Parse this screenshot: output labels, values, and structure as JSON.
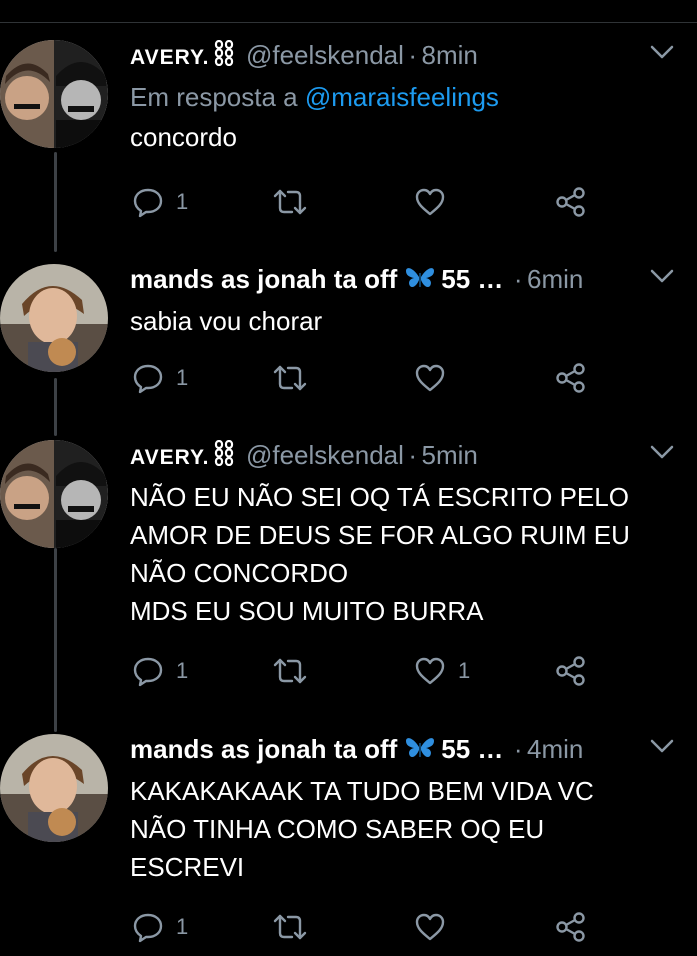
{
  "colors": {
    "background": "#000000",
    "text_primary": "#ffffff",
    "text_secondary": "#8b98a5",
    "mention": "#1d9bf0",
    "butterfly": "#2f8fe0",
    "thread_line": "#3d4146"
  },
  "icons": {
    "reply": "speech-bubble-icon",
    "retweet": "retweet-icon",
    "like": "heart-icon",
    "share": "share-icon",
    "more": "chevron-down-icon"
  },
  "tweets": [
    {
      "name": "AVERY.",
      "name_badge": "chain-icon",
      "handle": "@feelskendal",
      "sep": "·",
      "time": "8min",
      "reply_prefix": "Em resposta a",
      "reply_mention": "@maraisfeelings",
      "text": "concordo",
      "replies": "1",
      "likes": ""
    },
    {
      "name": "mands as jonah ta off",
      "name_badge": "butterfly-icon",
      "extra": "55 …",
      "sep": "·",
      "time": "6min",
      "text": "sabia vou chorar",
      "replies": "1",
      "likes": ""
    },
    {
      "name": "AVERY.",
      "name_badge": "chain-icon",
      "handle": "@feelskendal",
      "sep": "·",
      "time": "5min",
      "text": "NÃO EU NÃO SEI OQ TÁ ESCRITO PELO\nAMOR DE DEUS SE FOR ALGO RUIM EU\nNÃO CONCORDO\nMDS EU SOU MUITO BURRA",
      "replies": "1",
      "likes": "1"
    },
    {
      "name": "mands as jonah ta off",
      "name_badge": "butterfly-icon",
      "extra": "55 …",
      "sep": "·",
      "time": "4min",
      "text": "KAKAKAKAAK TA TUDO BEM VIDA VC\nNÃO TINHA COMO SABER OQ EU\nESCREVI",
      "replies": "1",
      "likes": ""
    }
  ]
}
